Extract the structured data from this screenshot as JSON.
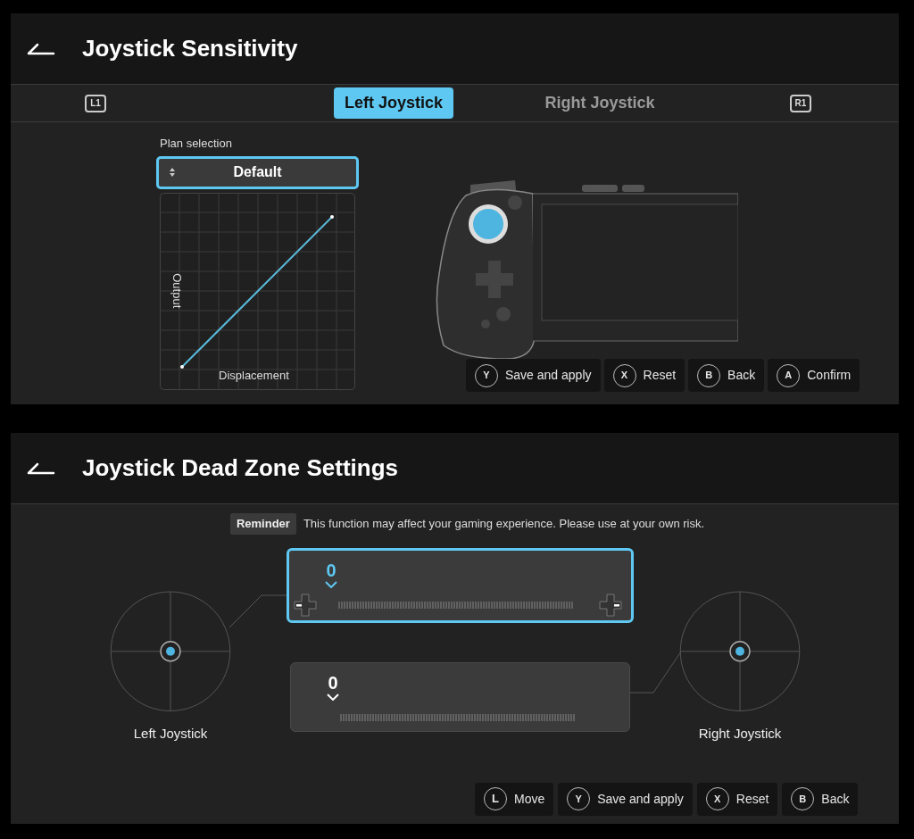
{
  "sensitivity": {
    "title": "Joystick Sensitivity",
    "tabs": [
      {
        "kind": "key",
        "label": "L1",
        "selected": false
      },
      {
        "kind": "tab",
        "label": "Left Joystick",
        "selected": true
      },
      {
        "kind": "tab",
        "label": "Right Joystick",
        "selected": false
      },
      {
        "kind": "key",
        "label": "R1",
        "selected": false
      }
    ],
    "plan_label": "Plan selection",
    "plan_value": "Default",
    "curve": {
      "ylabel": "Output",
      "xlabel": "Displacement"
    },
    "hints": [
      {
        "key": "Y",
        "label": "Save and apply"
      },
      {
        "key": "X",
        "label": "Reset"
      },
      {
        "key": "B",
        "label": "Back"
      },
      {
        "key": "A",
        "label": "Confirm"
      }
    ]
  },
  "dead_zone": {
    "title": "Joystick Dead Zone Settings",
    "reminder_tag": "Reminder",
    "reminder_text": "This function may affect your gaming experience. Please use at your own risk.",
    "joysticks": [
      {
        "label": "Left Joystick"
      },
      {
        "label": "Right Joystick"
      }
    ],
    "sliders": [
      {
        "value": "0",
        "selected": true
      },
      {
        "value": "0",
        "selected": false
      }
    ],
    "hints": [
      {
        "kind": "stick",
        "key": "L",
        "label": "Move"
      },
      {
        "kind": "button",
        "key": "Y",
        "label": "Save and apply"
      },
      {
        "kind": "button",
        "key": "X",
        "label": "Reset"
      },
      {
        "kind": "button",
        "key": "B",
        "label": "Back"
      }
    ]
  }
}
